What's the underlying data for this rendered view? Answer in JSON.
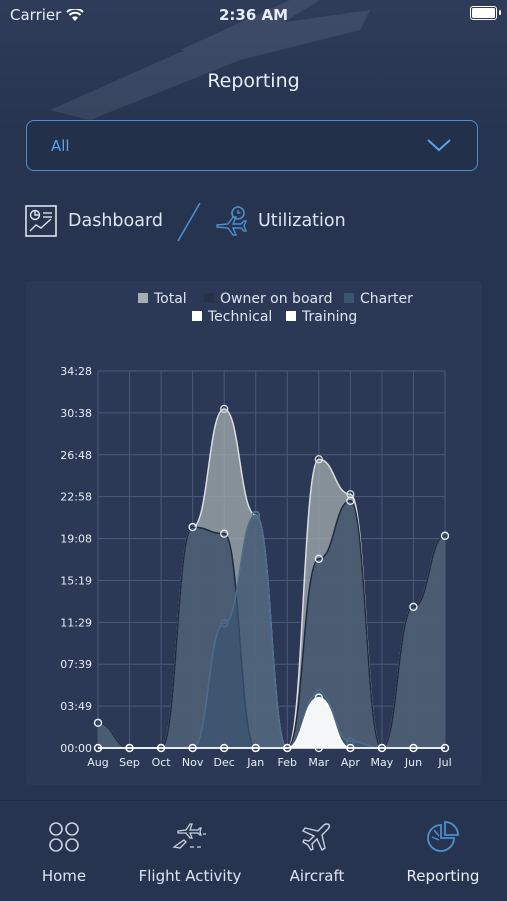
{
  "status_bar": {
    "carrier": "Carrier",
    "time": "2:36 AM"
  },
  "header": {
    "title": "Reporting"
  },
  "filter": {
    "value": "All"
  },
  "tabs": [
    {
      "label": "Dashboard",
      "icon": "dashboard-chart-icon"
    },
    {
      "label": "Utilization",
      "icon": "plane-clock-icon"
    }
  ],
  "bottom_nav": [
    {
      "label": "Home",
      "icon": "home-grid-icon"
    },
    {
      "label": "Flight Activity",
      "icon": "flight-activity-icon"
    },
    {
      "label": "Aircraft",
      "icon": "aircraft-icon"
    },
    {
      "label": "Reporting",
      "icon": "pie-chart-icon",
      "active": true
    }
  ],
  "colors": {
    "accent": "#4b8fcf",
    "total": "#a6aeb0",
    "owner_on_board": "#253248",
    "charter": "#3b5470",
    "technical": "#ffffff",
    "training": "#ffffff"
  },
  "chart_data": {
    "type": "area",
    "legend": [
      "Total",
      "Owner on board",
      "Charter",
      "Technical",
      "Training"
    ],
    "categories": [
      "Aug",
      "Sep",
      "Oct",
      "Nov",
      "Dec",
      "Jan",
      "Feb",
      "Mar",
      "Apr",
      "May",
      "Jun",
      "Jul"
    ],
    "y_ticks": [
      "00:00",
      "03:49",
      "07:39",
      "11:29",
      "15:19",
      "19:08",
      "22:58",
      "26:48",
      "30:38",
      "34:28"
    ],
    "ylim": [
      0,
      34.47
    ],
    "grid": true,
    "legend_position": "top",
    "series": [
      {
        "name": "Total",
        "values": [
          2.3,
          0,
          0,
          20.2,
          31.0,
          21.3,
          0,
          26.4,
          23.2,
          0,
          12.9,
          19.4
        ]
      },
      {
        "name": "Owner on board",
        "values": [
          2.3,
          0,
          0,
          20.2,
          19.6,
          0,
          0,
          17.3,
          22.6,
          0,
          12.9,
          19.4
        ]
      },
      {
        "name": "Charter",
        "values": [
          0,
          0,
          0,
          0,
          11.4,
          21.3,
          0,
          5.0,
          0.6,
          0,
          0,
          0
        ]
      },
      {
        "name": "Technical",
        "values": [
          0,
          0,
          0,
          0,
          0,
          0,
          0,
          4.6,
          0,
          0,
          0,
          0
        ]
      },
      {
        "name": "Training",
        "values": [
          0,
          0,
          0,
          0,
          0,
          0,
          0,
          0,
          0,
          0,
          0,
          0
        ]
      }
    ]
  }
}
